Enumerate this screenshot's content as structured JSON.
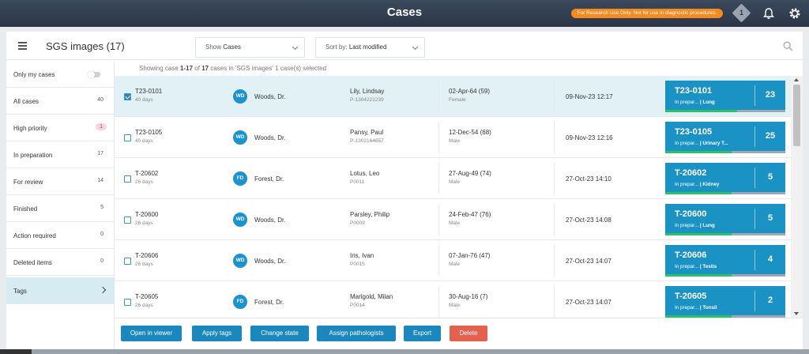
{
  "topbar": {
    "title": "Cases",
    "ruo_label": "For Research Use Only. Not for use in diagnostic procedures.",
    "notification_count": "1"
  },
  "header": {
    "title": "SGS images (17)",
    "show_prefix": "Show",
    "show_value": "Cases",
    "sort_prefix": "Sort by:",
    "sort_value": "Last modified"
  },
  "sidebar": {
    "items": [
      {
        "label": "Only my cases",
        "count": ""
      },
      {
        "label": "All cases",
        "count": "40"
      },
      {
        "label": "High priority",
        "count": "1"
      },
      {
        "label": "In preparation",
        "count": "17"
      },
      {
        "label": "For review",
        "count": "14"
      },
      {
        "label": "Finished",
        "count": "5"
      },
      {
        "label": "Action required",
        "count": "0"
      },
      {
        "label": "Deleted items",
        "count": "0"
      },
      {
        "label": "Tags",
        "count": ""
      }
    ]
  },
  "status": {
    "prefix": "Showing case",
    "range": "1-17",
    "middle": "of",
    "total": "17",
    "suffix": "cases in 'SGS images' 1 case(s) selected"
  },
  "cases": [
    {
      "id": "T23-0101",
      "days": "40 days",
      "initials": "WD",
      "doctor": "Woods, Dr.",
      "patient": "Lily, Lindsay",
      "pid": "P-1304221239",
      "dob": "02-Apr-64 (59)",
      "sex": "Female",
      "date": "09-Nov-23 12:17",
      "state": "In prepar...",
      "tag": "| Lung",
      "slides": "23",
      "progress": 0.6
    },
    {
      "id": "T23-0105",
      "days": "40 days",
      "initials": "WD",
      "doctor": "Woods, Dr.",
      "patient": "Pansy, Paul",
      "pid": "P-1302164657",
      "dob": "12-Dec-54 (68)",
      "sex": "Male",
      "date": "09-Nov-23 12:16",
      "state": "In prepar...",
      "tag": "| Urinary T...",
      "slides": "25",
      "progress": 0.55
    },
    {
      "id": "T-20602",
      "days": "26 days",
      "initials": "FD",
      "doctor": "Forest, Dr.",
      "patient": "Lotus, Leo",
      "pid": "P0011",
      "dob": "27-Aug-49 (74)",
      "sex": "Male",
      "date": "27-Oct-23 14:10",
      "state": "In prepar...",
      "tag": "| Kidney",
      "slides": "5",
      "progress": 0.55
    },
    {
      "id": "T-20600",
      "days": "26 days",
      "initials": "WD",
      "doctor": "Woods, Dr.",
      "patient": "Parsley, Philip",
      "pid": "P0009",
      "dob": "24-Feb-47 (76)",
      "sex": "Male",
      "date": "27-Oct-23 14:08",
      "state": "In prepar...",
      "tag": "| Lung",
      "slides": "5",
      "progress": 0.55
    },
    {
      "id": "T-20606",
      "days": "26 days",
      "initials": "WD",
      "doctor": "Woods, Dr.",
      "patient": "Iris, Ivan",
      "pid": "P0015",
      "dob": "07-Jan-76 (47)",
      "sex": "Male",
      "date": "27-Oct-23 14:07",
      "state": "In prepar...",
      "tag": "| Testis",
      "slides": "4",
      "progress": 0.55
    },
    {
      "id": "T-20605",
      "days": "26 days",
      "initials": "FD",
      "doctor": "Forest, Dr.",
      "patient": "Marigold, Milan",
      "pid": "P0014",
      "dob": "30-Aug-16 (7)",
      "sex": "Male",
      "date": "27-Oct-23 14:07",
      "state": "In prepar...",
      "tag": "| Tonsil",
      "slides": "2",
      "progress": 0.55
    }
  ],
  "actions": {
    "open": "Open in viewer",
    "tags": "Apply tags",
    "state": "Change state",
    "assign": "Assign pathologists",
    "export": "Export",
    "delete": "Delete"
  },
  "colors": {
    "accent": "#1a87bd",
    "tile": "#1a93c4",
    "delete": "#e4604f",
    "ruo": "#f58a1f",
    "progress": "#2fbf6b"
  }
}
